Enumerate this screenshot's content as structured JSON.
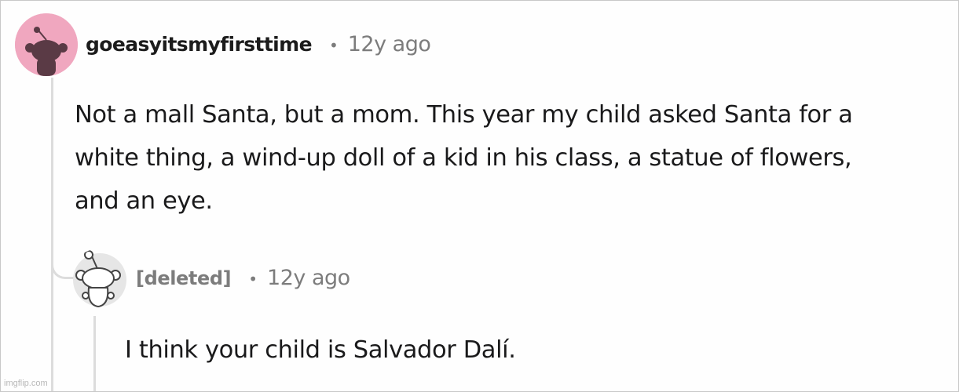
{
  "comments": [
    {
      "author": "goeasyitsmyfirsttime",
      "separator": "•",
      "age": "12y ago",
      "body_lines": [
        "Not a mall Santa, but a mom. This year my child asked Santa for a",
        "white thing, a wind-up doll of a kid in his class, a statue of flowers,",
        "and an eye."
      ],
      "avatar_icon": "snoo-avatar-icon",
      "avatar_color": "#f0a7bf"
    },
    {
      "author": "[deleted]",
      "separator": "•",
      "age": "12y ago",
      "body_lines": [
        "I think your child is Salvador Dalí."
      ],
      "avatar_icon": "snoo-avatar-icon",
      "avatar_color": "#e8e8e8"
    }
  ],
  "watermark": "imgflip.com"
}
